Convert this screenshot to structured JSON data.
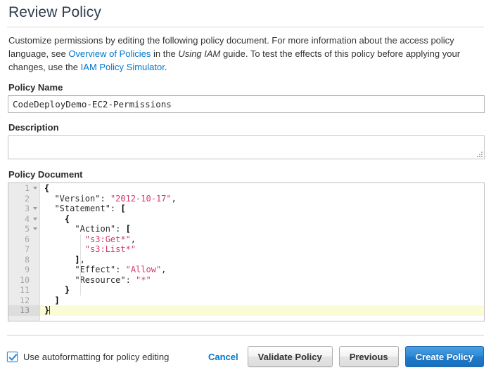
{
  "header": {
    "title": "Review Policy"
  },
  "intro": {
    "part1": "Customize permissions by editing the following policy document. For more information about the access policy language, see",
    "link1": "Overview of Policies",
    "part2": "in the",
    "italic": "Using IAM",
    "part3": "guide. To test the effects of this policy before applying your changes, use the",
    "link2": "IAM Policy Simulator",
    "part4": "."
  },
  "policy_name": {
    "label": "Policy Name",
    "value": "CodeDeployDemo-EC2-Permissions",
    "placeholder": ""
  },
  "description": {
    "label": "Description",
    "value": "",
    "placeholder": ""
  },
  "policy_document": {
    "label": "Policy Document",
    "lines": [
      {
        "n": "1",
        "fold": true,
        "segments": [
          {
            "t": "{",
            "c": "tok-punct"
          }
        ]
      },
      {
        "n": "2",
        "fold": false,
        "segments": [
          {
            "t": "  \"Version\": ",
            "c": ""
          },
          {
            "t": "\"2012-10-17\"",
            "c": "tok-str"
          },
          {
            "t": ",",
            "c": ""
          }
        ]
      },
      {
        "n": "3",
        "fold": true,
        "segments": [
          {
            "t": "  \"Statement\": ",
            "c": ""
          },
          {
            "t": "[",
            "c": "tok-punct"
          }
        ]
      },
      {
        "n": "4",
        "fold": true,
        "segments": [
          {
            "t": "    ",
            "c": ""
          },
          {
            "t": "{",
            "c": "tok-punct"
          }
        ]
      },
      {
        "n": "5",
        "fold": true,
        "segments": [
          {
            "t": "      \"Action\": ",
            "c": ""
          },
          {
            "t": "[",
            "c": "tok-punct"
          }
        ]
      },
      {
        "n": "6",
        "fold": false,
        "segments": [
          {
            "t": "        ",
            "c": ""
          },
          {
            "t": "\"s3:Get*\"",
            "c": "tok-str"
          },
          {
            "t": ",",
            "c": ""
          }
        ]
      },
      {
        "n": "7",
        "fold": false,
        "segments": [
          {
            "t": "        ",
            "c": ""
          },
          {
            "t": "\"s3:List*\"",
            "c": "tok-str"
          }
        ]
      },
      {
        "n": "8",
        "fold": false,
        "segments": [
          {
            "t": "      ",
            "c": ""
          },
          {
            "t": "]",
            "c": "tok-punct"
          },
          {
            "t": ",",
            "c": ""
          }
        ]
      },
      {
        "n": "9",
        "fold": false,
        "segments": [
          {
            "t": "      \"Effect\": ",
            "c": ""
          },
          {
            "t": "\"Allow\"",
            "c": "tok-str"
          },
          {
            "t": ",",
            "c": ""
          }
        ]
      },
      {
        "n": "10",
        "fold": false,
        "segments": [
          {
            "t": "      \"Resource\": ",
            "c": ""
          },
          {
            "t": "\"*\"",
            "c": "tok-str"
          }
        ]
      },
      {
        "n": "11",
        "fold": false,
        "segments": [
          {
            "t": "    ",
            "c": ""
          },
          {
            "t": "}",
            "c": "tok-punct"
          }
        ]
      },
      {
        "n": "12",
        "fold": false,
        "segments": [
          {
            "t": "  ",
            "c": ""
          },
          {
            "t": "]",
            "c": "tok-punct"
          }
        ]
      },
      {
        "n": "13",
        "fold": false,
        "active": true,
        "caret": true,
        "segments": [
          {
            "t": "}",
            "c": "tok-punct"
          }
        ]
      }
    ]
  },
  "footer": {
    "autoformat_label": "Use autoformatting for policy editing",
    "autoformat_checked": true,
    "cancel_label": "Cancel",
    "validate_label": "Validate Policy",
    "previous_label": "Previous",
    "create_label": "Create Policy"
  },
  "colors": {
    "link": "#0077cc",
    "primary_button": "#1f7ccb",
    "string_token": "#d4386c",
    "title": "#2f3d4f",
    "active_line": "#fbfbd6",
    "gutter": "#ebebeb"
  }
}
